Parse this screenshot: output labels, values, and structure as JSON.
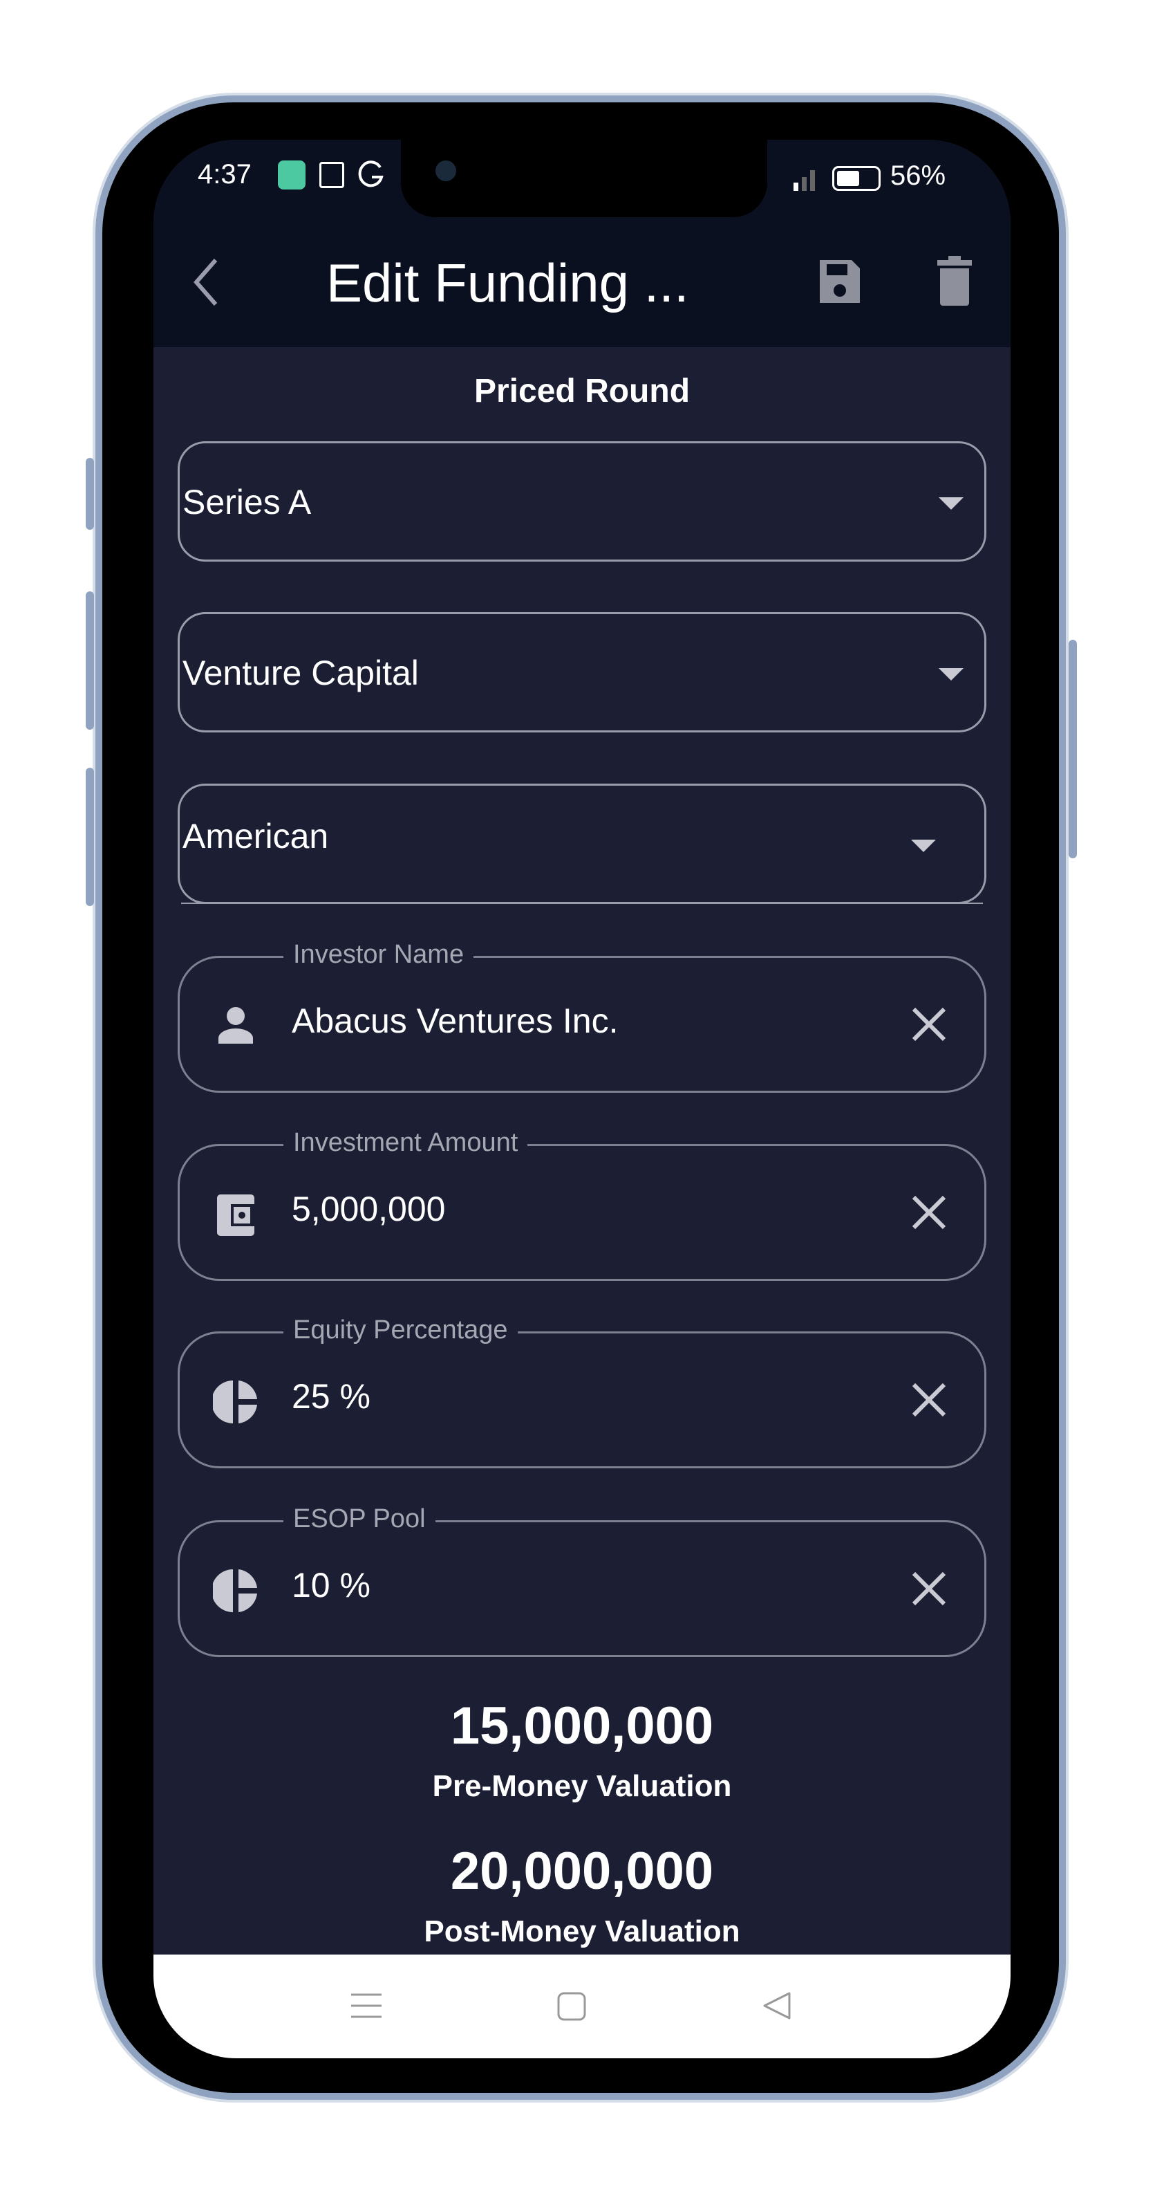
{
  "status_bar": {
    "time": "4:37",
    "battery": "56%",
    "battery_level": 0.56
  },
  "app_bar": {
    "title": "Edit Funding ...",
    "icons": [
      "back-icon",
      "save-icon",
      "delete-icon"
    ]
  },
  "form": {
    "section_title": "Priced Round",
    "dropdowns": [
      {
        "value": "Series A"
      },
      {
        "value": "Venture Capital"
      },
      {
        "value": "American"
      }
    ],
    "fields": [
      {
        "label": "Investor Name",
        "value": "Abacus Ventures Inc.",
        "icon": "person-icon"
      },
      {
        "label": "Investment Amount",
        "value": "5,000,000",
        "icon": "wallet-icon"
      },
      {
        "label": "Equity Percentage",
        "value": "25 %",
        "icon": "pie-chart-icon"
      },
      {
        "label": "ESOP Pool",
        "value": "10 %",
        "icon": "pie-chart-icon"
      }
    ]
  },
  "summary": {
    "pre_money_value": "15,000,000",
    "pre_money_label": "Pre-Money Valuation",
    "post_money_value": "20,000,000",
    "post_money_label": "Post-Money Valuation"
  },
  "colors": {
    "background": "#1c1f33",
    "app_bar": "#0a1020",
    "accent_status_icon": "#4cc9a0"
  }
}
